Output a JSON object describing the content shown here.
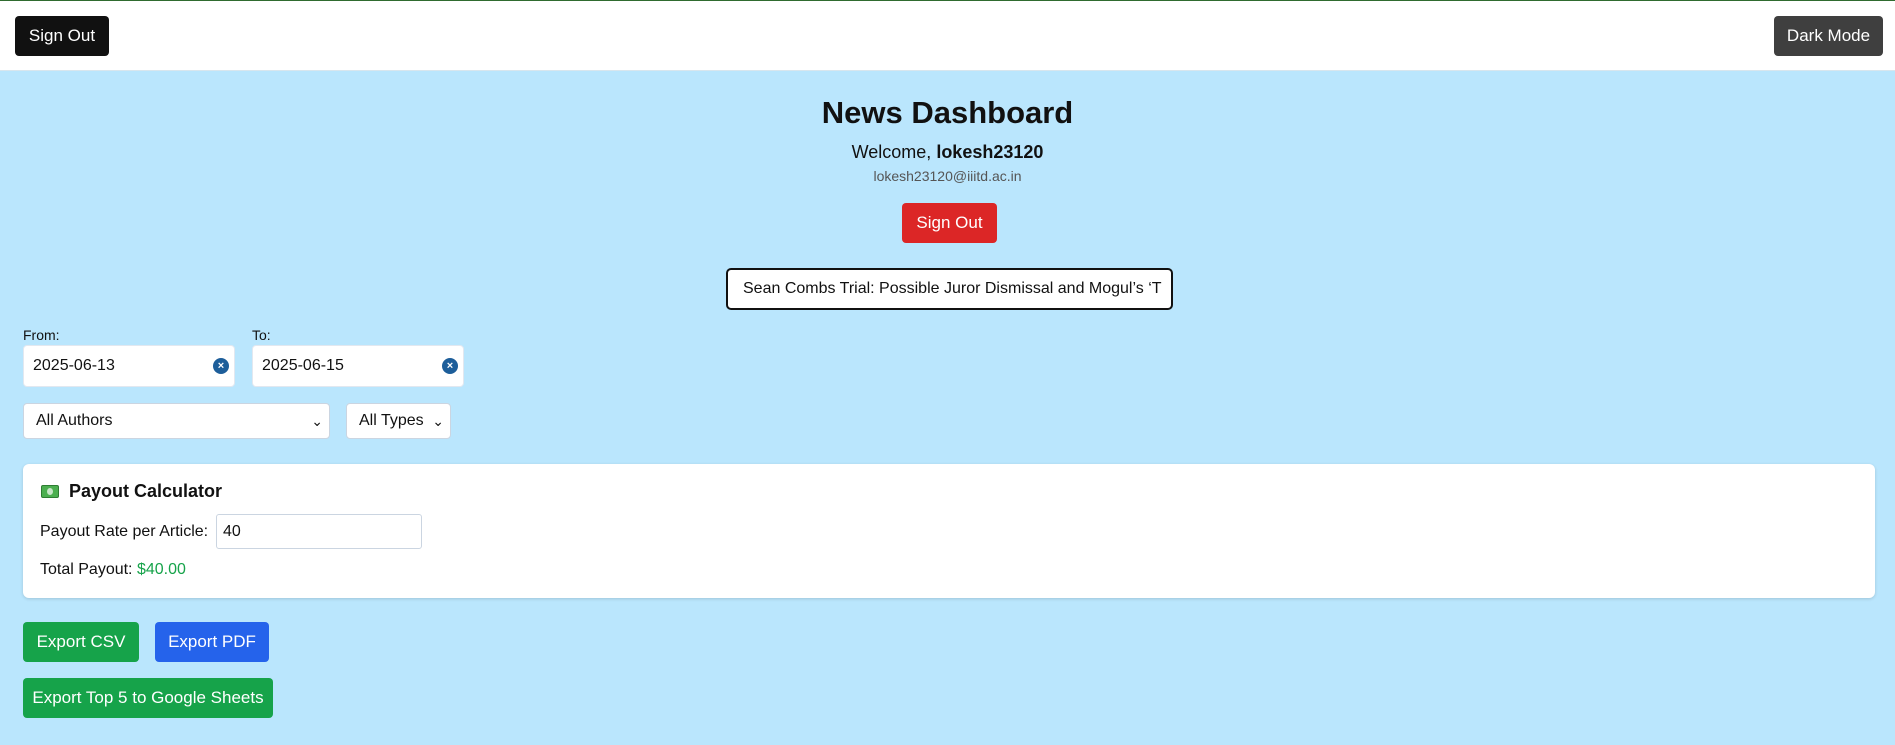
{
  "topbar": {
    "signout_label": "Sign Out",
    "darkmode_label": "Dark Mode"
  },
  "header": {
    "title": "News Dashboard",
    "welcome_prefix": "Welcome,",
    "username": "lokesh23120",
    "email": "lokesh23120@iiitd.ac.in",
    "signout_label": "Sign Out"
  },
  "ticker": {
    "text": "Sean Combs Trial: Possible Juror Dismissal and Mogul’s ‘T"
  },
  "filters": {
    "from_label": "From:",
    "from_value": "2025-06-13",
    "to_label": "To:",
    "to_value": "2025-06-15",
    "author_selected": "All Authors",
    "type_selected": "All Types"
  },
  "payout": {
    "title": "Payout Calculator",
    "rate_label": "Payout Rate per Article:",
    "rate_value": "40",
    "total_label": "Total Payout:",
    "total_value": "$40.00"
  },
  "exports": {
    "csv_label": "Export CSV",
    "pdf_label": "Export PDF",
    "sheets_label": "Export Top 5 to Google Sheets"
  },
  "colors": {
    "background": "#bae6fd",
    "signout_red": "#dc2626",
    "export_green": "#16a34a",
    "export_blue": "#2563eb"
  }
}
